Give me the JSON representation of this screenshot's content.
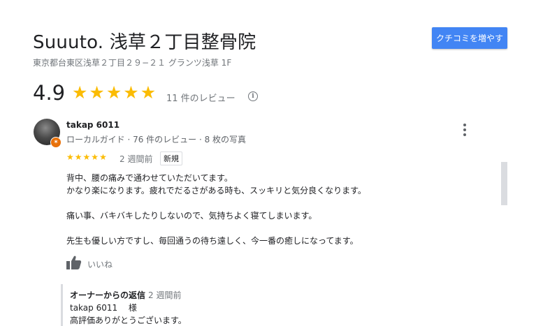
{
  "header": {
    "title": "Suuuto. 浅草２丁目整骨院",
    "cta_label": "クチコミを増やす",
    "address": "東京都台東区浅草２丁目２９−２１ グランツ浅草 1F"
  },
  "summary": {
    "rating": "4.9",
    "star_count": 5,
    "review_count": "11 件のレビュー",
    "icons": {
      "info": "info-icon"
    }
  },
  "review": {
    "author": "takap 6011",
    "author_meta": "ローカルガイド · 76 件のレビュー · 8 枚の写真",
    "stars": 5,
    "date": "2 週間前",
    "badge": "新規",
    "lines": [
      "背中、腰の痛みで通わせていただいてます。",
      "かなり楽になります。疲れでだるさがある時も、スッキリと気分良くなります。",
      "痛い事、バキバキしたりしないので、気持ちよく寝てしまいます。",
      "先生も優しい方ですし、毎回通うの待ち遠しく、今一番の癒しになってます。"
    ],
    "like_label": "いいね",
    "icons": {
      "avatar_badge": "local-guide-badge-icon",
      "more": "more-vert-icon",
      "like": "thumbs-up-icon"
    }
  },
  "owner_response": {
    "title": "オーナーからの返信",
    "date": "2 週間前",
    "line1": "takap 6011　 様",
    "line2": "高評価ありがとうございます。"
  },
  "colors": {
    "accent": "#4285f4",
    "star": "#fbbc04",
    "badge": "#e8710a",
    "muted_text": "#70757a"
  }
}
